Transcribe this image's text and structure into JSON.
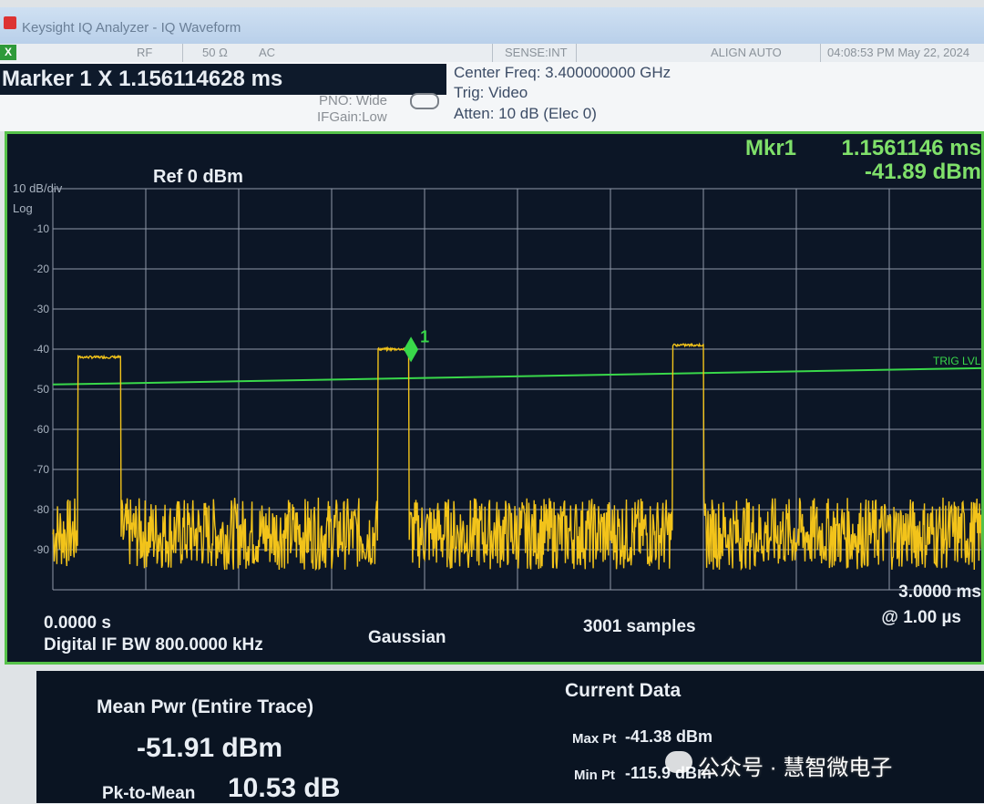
{
  "window": {
    "title": "Keysight IQ Analyzer - IQ Waveform"
  },
  "status": {
    "x_icon": "X",
    "rf": "RF",
    "impedance": "50 Ω",
    "coupling": "AC",
    "sense": "SENSE:INT",
    "align": "ALIGN AUTO",
    "clock": "04:08:53 PM May 22, 2024"
  },
  "marker_readout": "Marker 1 X 1.156114628 ms",
  "settings": {
    "pno": "PNO: Wide",
    "ifgain": "IFGain:Low",
    "center_freq": "Center Freq: 3.400000000 GHz",
    "trig": "Trig: Video",
    "atten": "Atten: 10 dB (Elec 0)"
  },
  "display": {
    "mkr_label": "Mkr1",
    "mkr_x": "1.1561146 ms",
    "mkr_y": "-41.89 dBm",
    "ref": "Ref 0 dBm",
    "scale": "10 dB/div",
    "log": "Log",
    "trig_lvl": "TRIG LVL",
    "marker_num": "1",
    "x_start": "0.0000 s",
    "x_stop": "3.0000 ms",
    "resolution": "@ 1.00 µs",
    "if_bw": "Digital IF BW 800.0000 kHz",
    "filter": "Gaussian",
    "samples": "3001  samples",
    "colors": {
      "trace": "#f2c31a",
      "grid": "#8f98a8",
      "trigger": "#39d84a",
      "border": "#56c24a"
    }
  },
  "chart_data": {
    "type": "line",
    "title": "",
    "xlabel": "",
    "ylabel": "",
    "xlim": [
      0,
      3.0
    ],
    "ylim": [
      -100,
      0
    ],
    "y_tick_labels": [
      "-10",
      "-20",
      "-30",
      "-40",
      "-50",
      "-60",
      "-70",
      "-80",
      "-90"
    ],
    "trigger_level": -47,
    "pulses": [
      {
        "start_ms": 0.08,
        "end_ms": 0.22,
        "level_dbm": -42
      },
      {
        "start_ms": 1.05,
        "end_ms": 1.15,
        "level_dbm": -40
      },
      {
        "start_ms": 2.0,
        "end_ms": 2.1,
        "level_dbm": -39
      }
    ],
    "noise_floor_dbm": [
      -95,
      -77
    ],
    "marker": {
      "x_ms": 1.1561146,
      "y_dbm": -41.89
    }
  },
  "measurements": {
    "mean_pwr_label": "Mean Pwr (Entire Trace)",
    "mean_pwr": "-51.91 dBm",
    "pk_to_mean_label": "Pk-to-Mean",
    "pk_to_mean": "10.53 dB",
    "current_data": "Current Data",
    "max_pt_label": "Max Pt",
    "max_pt": "-41.38 dBm",
    "min_pt_label": "Min Pt",
    "min_pt": "-115.9 dBm"
  },
  "watermark": "公众号 · 慧智微电子"
}
